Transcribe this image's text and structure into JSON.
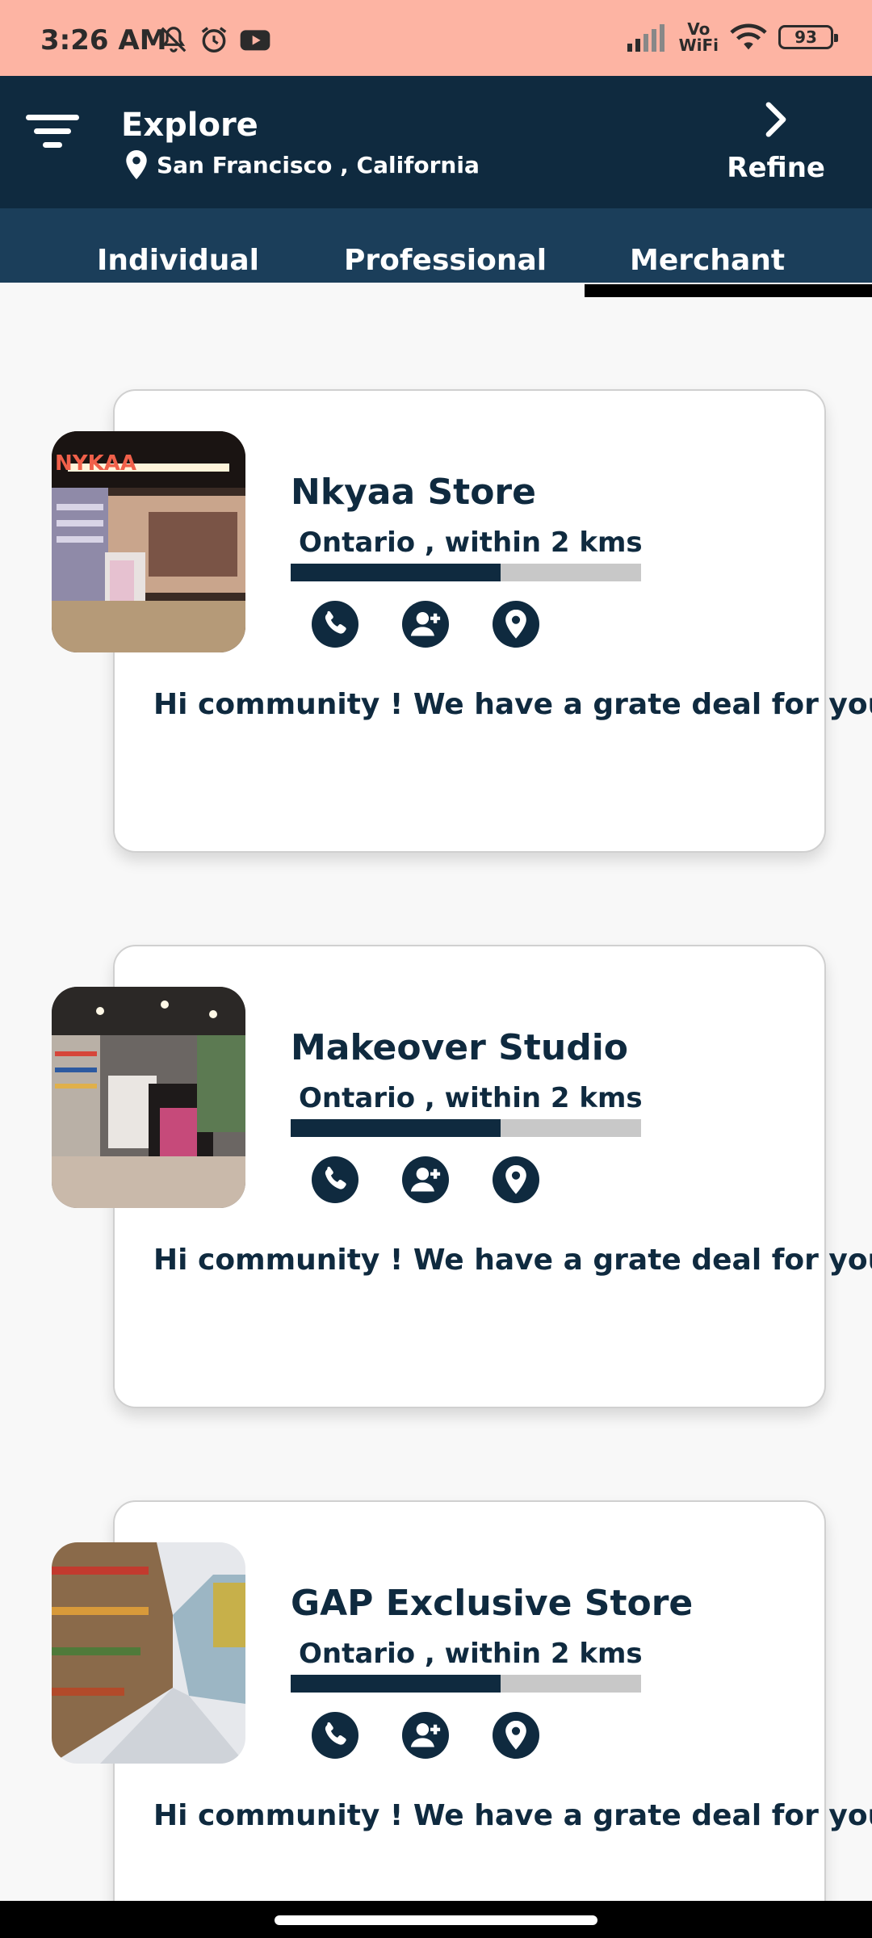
{
  "status_bar": {
    "time": "3:26 AM",
    "icons": [
      "mute-icon",
      "alarm-icon",
      "youtube-icon",
      "signal-icon",
      "wifi-icon"
    ],
    "volte_top": "Vo",
    "volte_bottom": "WiFi",
    "battery": "93"
  },
  "header": {
    "title": "Explore",
    "location": "San Francisco , California",
    "refine_label": "Refine"
  },
  "tabs": [
    {
      "label": "Individual"
    },
    {
      "label": "Professional"
    },
    {
      "label": "Merchant",
      "active": true
    }
  ],
  "cards": [
    {
      "name": "Nkyaa Store",
      "subtitle": "Ontario , within 2 kms",
      "progress": 0.6,
      "message": "Hi community ! We have a grate deal for you",
      "thumb_sign": "NYKAA"
    },
    {
      "name": "Makeover Studio",
      "subtitle": "Ontario , within 2 kms",
      "progress": 0.6,
      "message": "Hi community ! We have a grate deal for you"
    },
    {
      "name": "GAP Exclusive Store",
      "subtitle": "Ontario , within 2 kms",
      "progress": 0.6,
      "message": "Hi community ! We have a grate deal for you"
    }
  ],
  "colors": {
    "status_bar": "#fdb4a3",
    "header": "#0f2a3f",
    "tab_bar": "#1b3e5a",
    "accent_dark": "#0f2a3f",
    "progress_track": "#c8c8c8"
  }
}
